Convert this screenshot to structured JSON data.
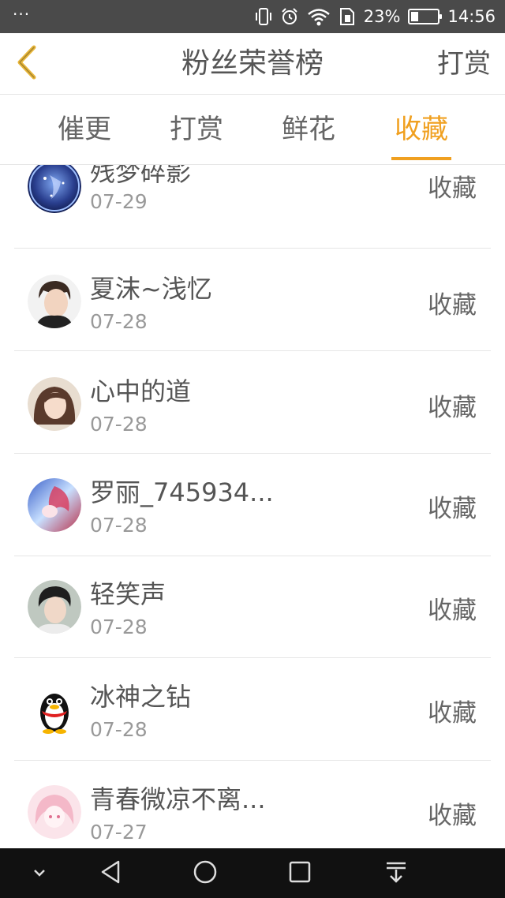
{
  "status_bar": {
    "menu_dots": "···",
    "battery_percent": "23%",
    "battery_level": 0.23,
    "time": "14:56",
    "icons": [
      "vibrate-icon",
      "alarm-icon",
      "wifi-icon",
      "sim-icon",
      "battery-icon"
    ]
  },
  "header": {
    "back_icon": "chevron-left-icon",
    "title": "粉丝荣誉榜",
    "action_label": "打赏"
  },
  "tabs": [
    {
      "label": "催更",
      "active": false
    },
    {
      "label": "打赏",
      "active": false
    },
    {
      "label": "鲜花",
      "active": false
    },
    {
      "label": "收藏",
      "active": true
    }
  ],
  "list": {
    "items": [
      {
        "name": "残梦碎影",
        "date": "07-29",
        "action": "收藏",
        "avatar": "avatar-galaxy"
      },
      {
        "name": "夏沫~浅忆",
        "date": "07-28",
        "action": "收藏",
        "avatar": "avatar-boy"
      },
      {
        "name": "心中的道",
        "date": "07-28",
        "action": "收藏",
        "avatar": "avatar-girl"
      },
      {
        "name": "罗丽_745934...",
        "date": "07-28",
        "action": "收藏",
        "avatar": "avatar-anime"
      },
      {
        "name": "轻笑声",
        "date": "07-28",
        "action": "收藏",
        "avatar": "avatar-young-man"
      },
      {
        "name": "冰神之钻",
        "date": "07-28",
        "action": "收藏",
        "avatar": "avatar-qq-penguin"
      },
      {
        "name": "青春微凉不离...",
        "date": "07-27",
        "action": "收藏",
        "avatar": "avatar-pink-anime"
      }
    ]
  },
  "colors": {
    "accent": "#f0a020",
    "status_bar": "#4a4a4a",
    "nav_bar": "#111111",
    "text": "#555555",
    "subtext": "#999999",
    "divider": "#e6e6e6"
  },
  "navbar": {
    "icons": [
      "chevron-down-icon",
      "back-triangle-icon",
      "home-circle-icon",
      "recents-square-icon",
      "notification-pull-icon"
    ]
  }
}
